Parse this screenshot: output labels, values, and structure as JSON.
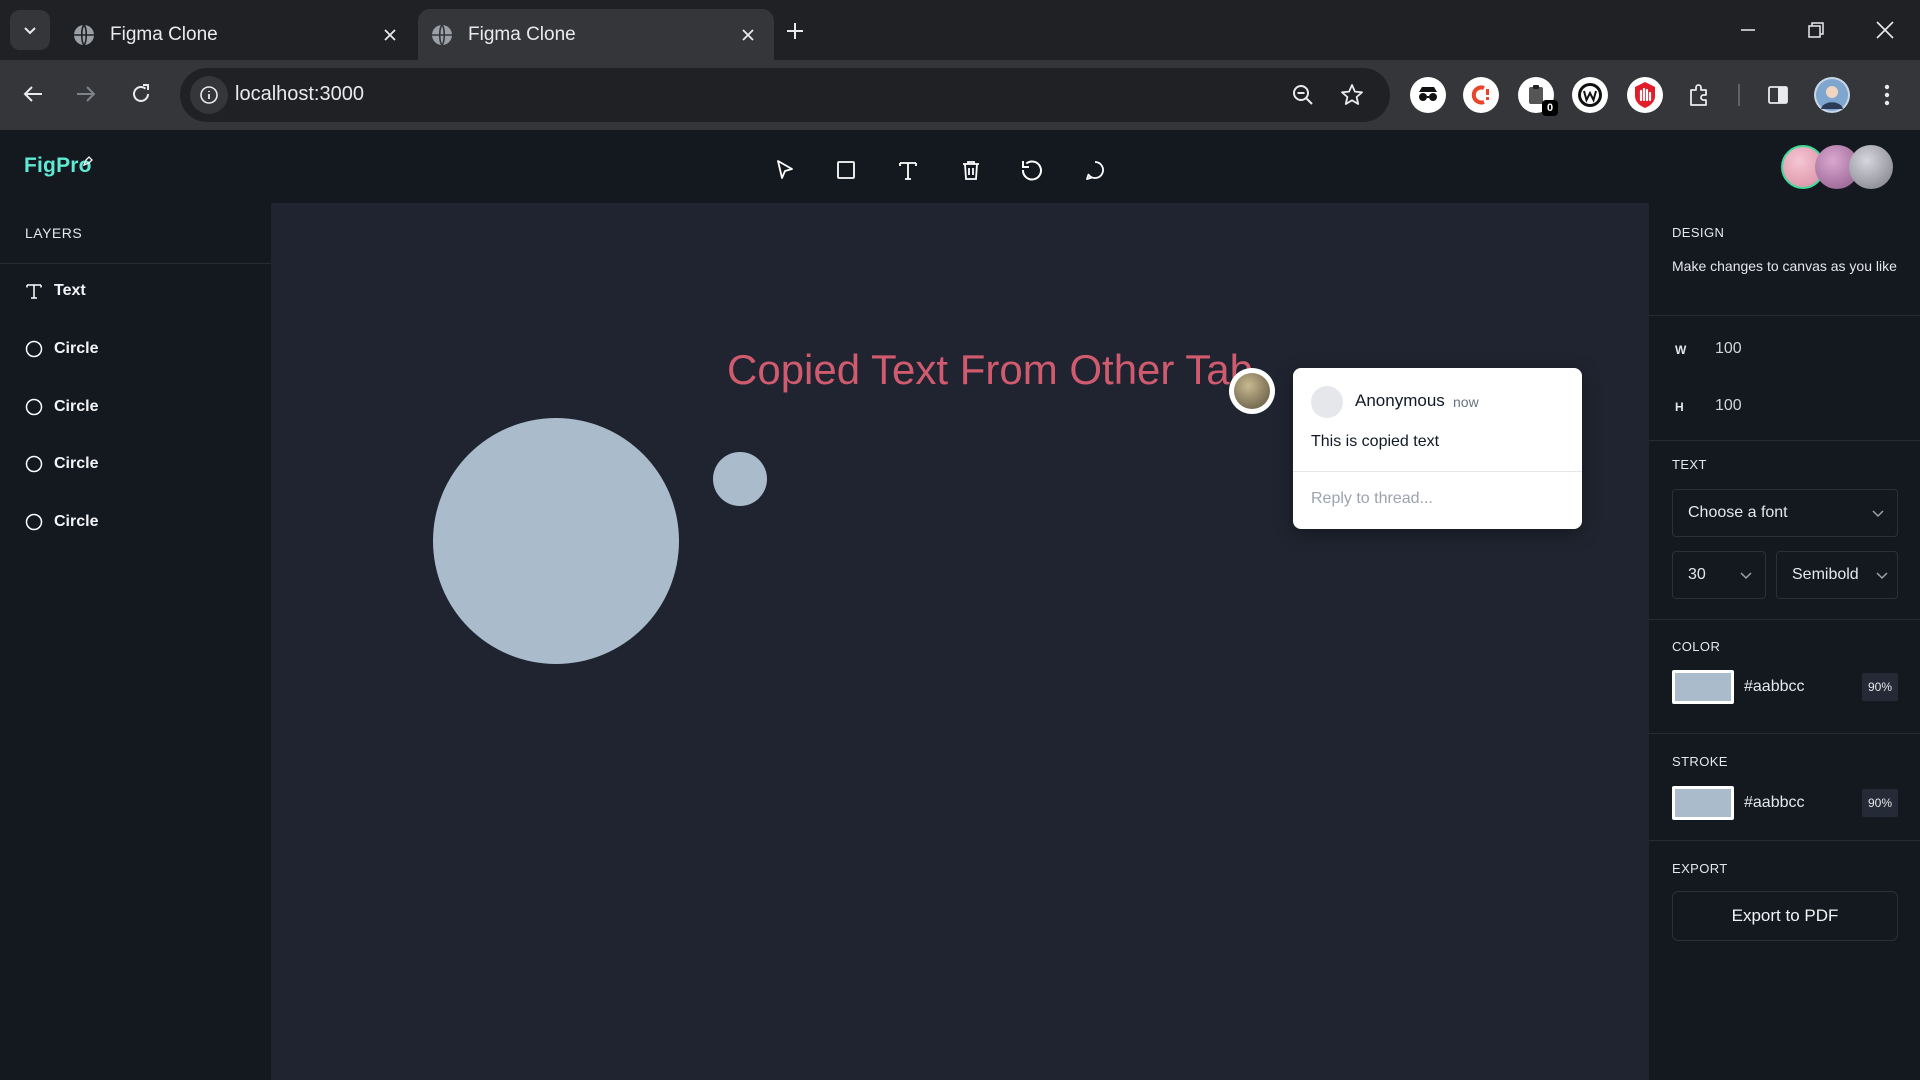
{
  "browser": {
    "tabs": [
      {
        "title": "Figma Clone",
        "active": false
      },
      {
        "title": "Figma Clone",
        "active": true
      }
    ],
    "url": "localhost:3000",
    "extension_badge": "0"
  },
  "app": {
    "logo": "FigPro",
    "tools": [
      "select-icon",
      "rectangle-icon",
      "text-icon",
      "trash-icon",
      "reset-icon",
      "comment-icon"
    ],
    "collaborator_colors": [
      "#e9a3b5",
      "#b07aa8",
      "#a5a5b0"
    ]
  },
  "layers": {
    "heading": "LAYERS",
    "items": [
      {
        "icon": "text-icon",
        "label": "Text"
      },
      {
        "icon": "circle-icon",
        "label": "Circle"
      },
      {
        "icon": "circle-icon",
        "label": "Circle"
      },
      {
        "icon": "circle-icon",
        "label": "Circle"
      },
      {
        "icon": "circle-icon",
        "label": "Circle"
      }
    ]
  },
  "canvas": {
    "text_object": "Copied Text From Other Tab",
    "text_color": "#d05a6e",
    "shape_fill": "#aabbcc"
  },
  "comment": {
    "author": "Anonymous",
    "time": "now",
    "body": "This is copied text",
    "reply_placeholder": "Reply to thread..."
  },
  "design": {
    "heading": "DESIGN",
    "subtitle": "Make changes to canvas as you like",
    "width_label": "W",
    "width_value": "100",
    "height_label": "H",
    "height_value": "100",
    "text_heading": "TEXT",
    "font_family_placeholder": "Choose a font",
    "font_size": "30",
    "font_weight": "Semibold",
    "color_heading": "COLOR",
    "fill_hex": "#aabbcc",
    "fill_opacity": "90%",
    "stroke_heading": "STROKE",
    "stroke_hex": "#aabbcc",
    "stroke_opacity": "90%",
    "export_heading": "EXPORT",
    "export_button": "Export to PDF"
  }
}
